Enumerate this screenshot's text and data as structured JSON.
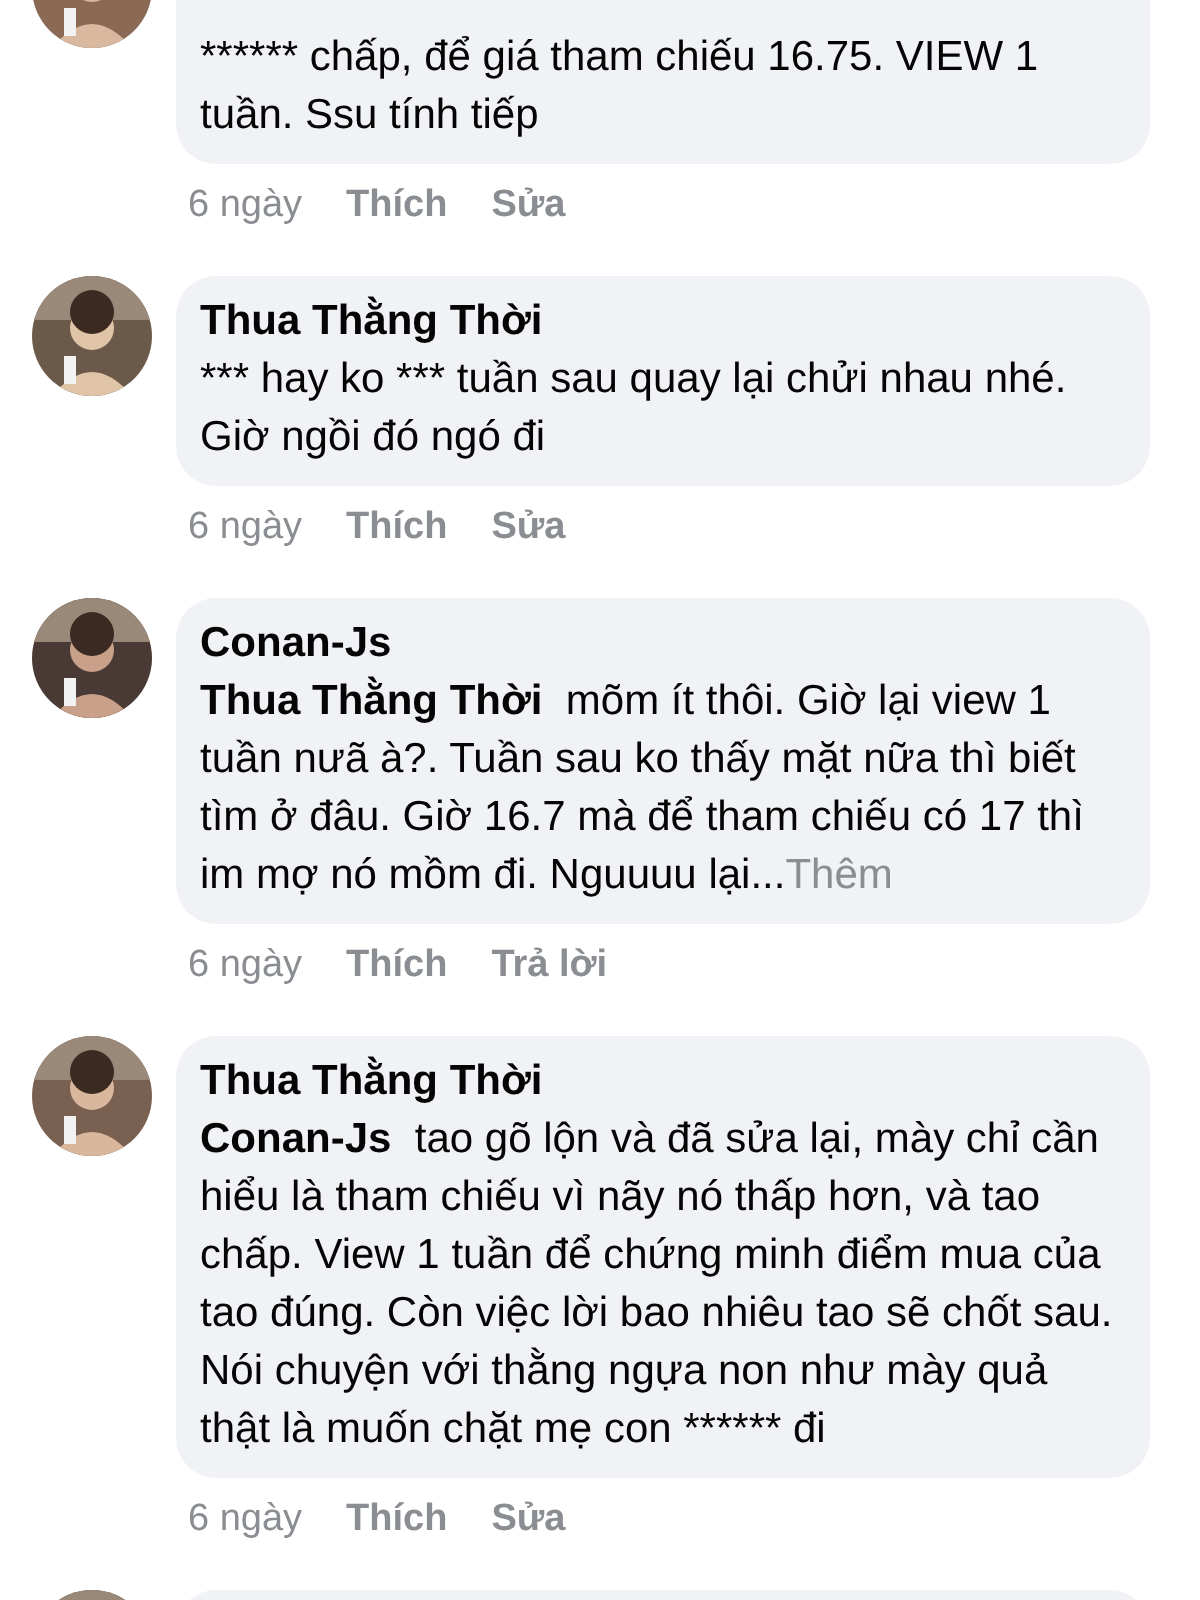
{
  "comments": [
    {
      "avatar": {
        "kind": "picture"
      },
      "text": "****** chấp, để giá tham chiếu 16.75. VIEW 1 tuần. Ssu tính tiếp",
      "time": "6 ngày",
      "actions": [
        "Thích",
        "Sửa"
      ]
    },
    {
      "avatar": {
        "kind": "picture"
      },
      "author": "Thua Thằng Thời",
      "text": "*** hay ko *** tuần sau quay lại chửi nhau nhé. Giờ ngồi đó ngó đi",
      "time": "6 ngày",
      "actions": [
        "Thích",
        "Sửa"
      ]
    },
    {
      "avatar": {
        "kind": "picture"
      },
      "author": "Conan-Js",
      "mention": "Thua Thằng Thời",
      "text": "mõm ít thôi. Giờ lại view 1 tuần nưã à?. Tuần sau ko thấy mặt nữa thì biết tìm ở đâu. Giờ 16.7 mà để tham chiếu có 17 thì im mợ nó mồm đi. Nguuuu lại...",
      "more": "Thêm",
      "time": "6 ngày",
      "actions": [
        "Thích",
        "Trả lời"
      ]
    },
    {
      "avatar": {
        "kind": "picture"
      },
      "author": "Thua Thằng Thời",
      "mention": "Conan-Js",
      "text": "tao gõ lộn và đã sửa lại, mày chỉ cần hiểu là tham chiếu vì nãy nó thấp hơn, và tao chấp. View 1 tuần để chứng minh điểm mua của tao đúng. Còn việc lời bao nhiêu tao sẽ chốt sau. Nói chuyện với thằng ngựa non như mày quả thật là muốn chặt mẹ con ****** đi",
      "time": "6 ngày",
      "actions": [
        "Thích",
        "Sửa"
      ]
    },
    {
      "avatar": {
        "kind": "picture"
      }
    }
  ]
}
